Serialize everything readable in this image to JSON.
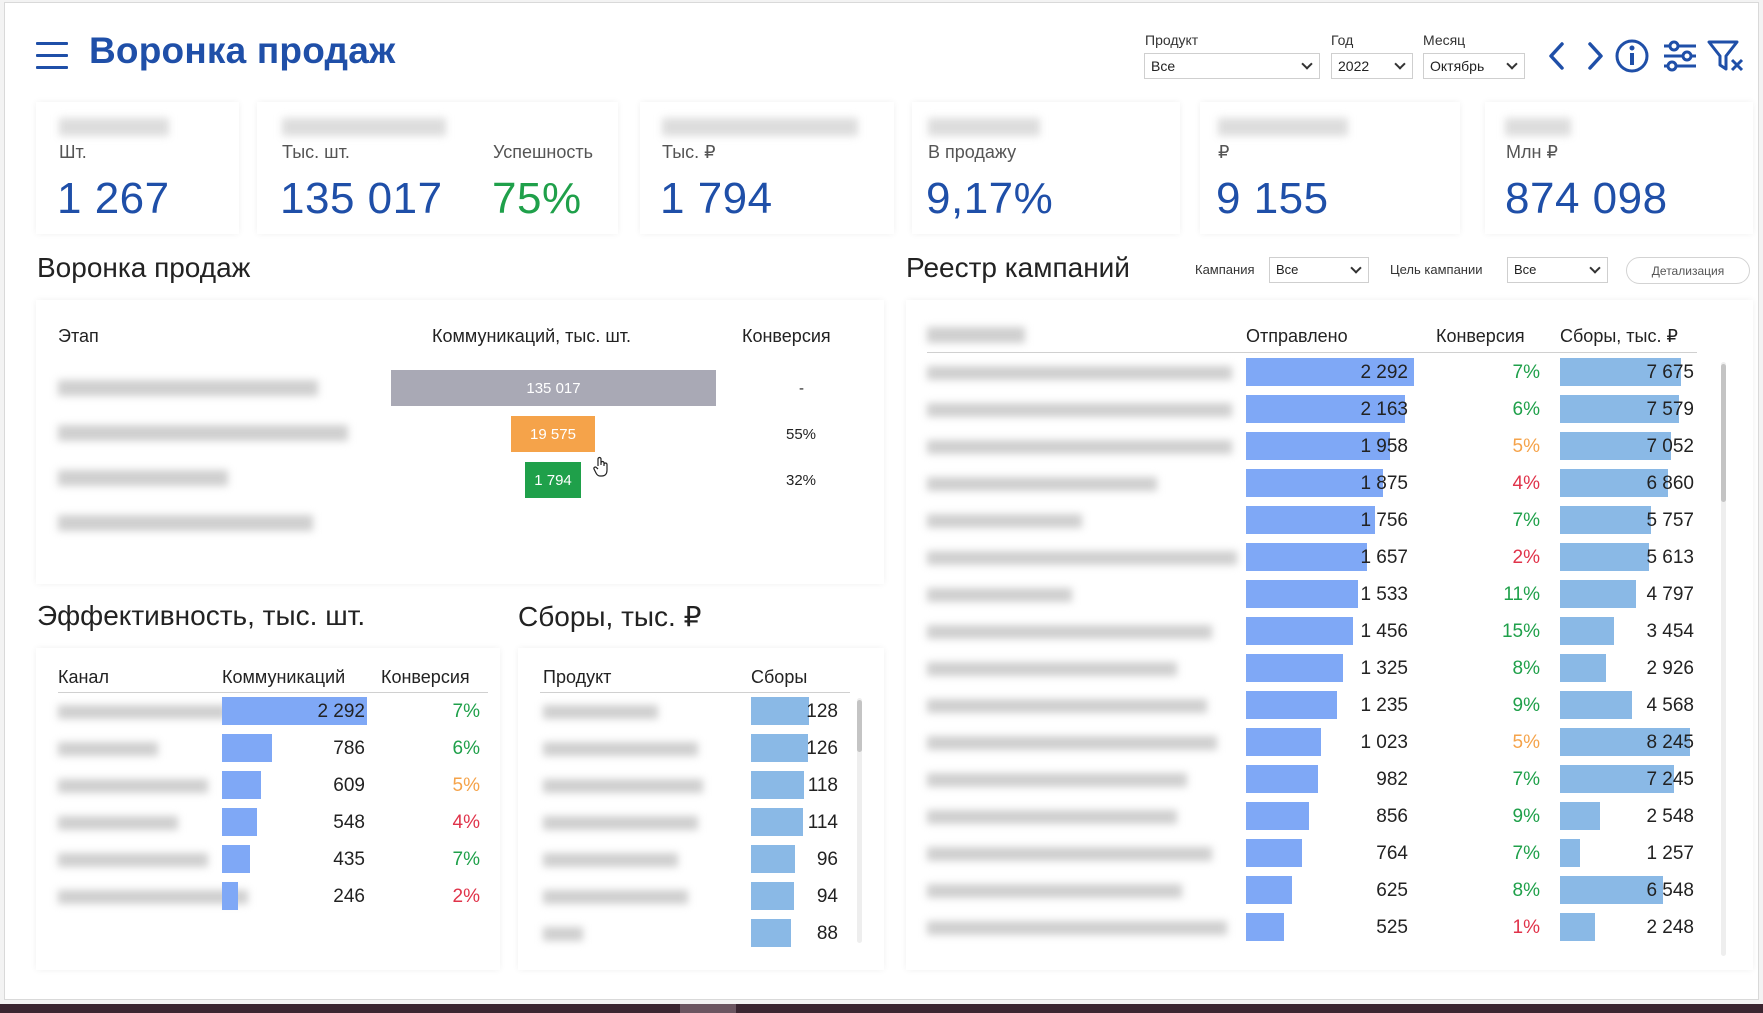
{
  "header": {
    "title": "Воронка продаж",
    "filters": [
      {
        "label": "Продукт",
        "value": "Все"
      },
      {
        "label": "Год",
        "value": "2022"
      },
      {
        "label": "Месяц",
        "value": "Октябрь"
      }
    ],
    "icons": [
      "chevron-left-icon",
      "chevron-right-icon",
      "info-icon",
      "sliders-icon",
      "filter-clear-icon"
    ]
  },
  "kpis": [
    {
      "unit": "Шт.",
      "value": "1 267"
    },
    {
      "unit": "Тыс. шт.",
      "value": "135 017"
    },
    {
      "unit": "Успешность",
      "value": "75%"
    },
    {
      "unit": "Тыс. ₽",
      "value": "1 794"
    },
    {
      "unit": "В продажу",
      "value": "9,17%"
    },
    {
      "unit": "₽",
      "value": "9 155"
    },
    {
      "unit": "Млн ₽",
      "value": "874 098"
    }
  ],
  "funnel": {
    "title": "Воронка продаж",
    "col_stage": "Этап",
    "col_comm": "Коммуникаций, тыс. шт.",
    "col_conv": "Конверсия",
    "rows": [
      {
        "value": "135 017",
        "conv": "-",
        "color": "#a9a9b5"
      },
      {
        "value": "19 575",
        "conv": "55%",
        "color": "#f5a34a"
      },
      {
        "value": "1 794",
        "conv": "32%",
        "color": "#1fa04a"
      }
    ]
  },
  "efficiency": {
    "title": "Эффективность, тыс. шт.",
    "col_channel": "Канал",
    "col_comm": "Коммуникаций",
    "col_conv": "Конверсия",
    "rows": [
      {
        "value": "2 292",
        "conv": "7%"
      },
      {
        "value": "786",
        "conv": "6%"
      },
      {
        "value": "609",
        "conv": "5%"
      },
      {
        "value": "548",
        "conv": "4%"
      },
      {
        "value": "435",
        "conv": "7%"
      },
      {
        "value": "246",
        "conv": "2%"
      }
    ]
  },
  "collections": {
    "title": "Сборы, тыс. ₽",
    "col_product": "Продукт",
    "col_sum": "Сборы",
    "rows": [
      "128",
      "126",
      "118",
      "114",
      "96",
      "94",
      "88"
    ]
  },
  "registry": {
    "title": "Реестр кампаний",
    "filter_campaign_label": "Кампания",
    "filter_campaign_value": "Все",
    "filter_goal_label": "Цель кампании",
    "filter_goal_value": "Все",
    "detail_button": "Детализация",
    "col_sent": "Отправлено",
    "col_conv": "Конверсия",
    "col_sum": "Сборы, тыс. ₽",
    "rows": [
      {
        "sent": "2 292",
        "conv": "7%",
        "sum": "7 675"
      },
      {
        "sent": "2 163",
        "conv": "6%",
        "sum": "7 579"
      },
      {
        "sent": "1 958",
        "conv": "5%",
        "sum": "7 052"
      },
      {
        "sent": "1 875",
        "conv": "4%",
        "sum": "6 860"
      },
      {
        "sent": "1 756",
        "conv": "7%",
        "sum": "5 757"
      },
      {
        "sent": "1 657",
        "conv": "2%",
        "sum": "5 613"
      },
      {
        "sent": "1 533",
        "conv": "11%",
        "sum": "4 797"
      },
      {
        "sent": "1 456",
        "conv": "15%",
        "sum": "3 454"
      },
      {
        "sent": "1 325",
        "conv": "8%",
        "sum": "2 926"
      },
      {
        "sent": "1 235",
        "conv": "9%",
        "sum": "4 568"
      },
      {
        "sent": "1 023",
        "conv": "5%",
        "sum": "8 245"
      },
      {
        "sent": "982",
        "conv": "7%",
        "sum": "7 245"
      },
      {
        "sent": "856",
        "conv": "9%",
        "sum": "2 548"
      },
      {
        "sent": "764",
        "conv": "7%",
        "sum": "1 257"
      },
      {
        "sent": "625",
        "conv": "8%",
        "sum": "6 548"
      },
      {
        "sent": "525",
        "conv": "1%",
        "sum": "2 248"
      }
    ]
  },
  "colors": {
    "accent": "#1f4fa8",
    "good": "#1fa04a",
    "warn": "#f5a34a",
    "bad": "#e0334a",
    "bar_blue": "#7fa8f6",
    "bar_light": "#8ab9e6"
  }
}
